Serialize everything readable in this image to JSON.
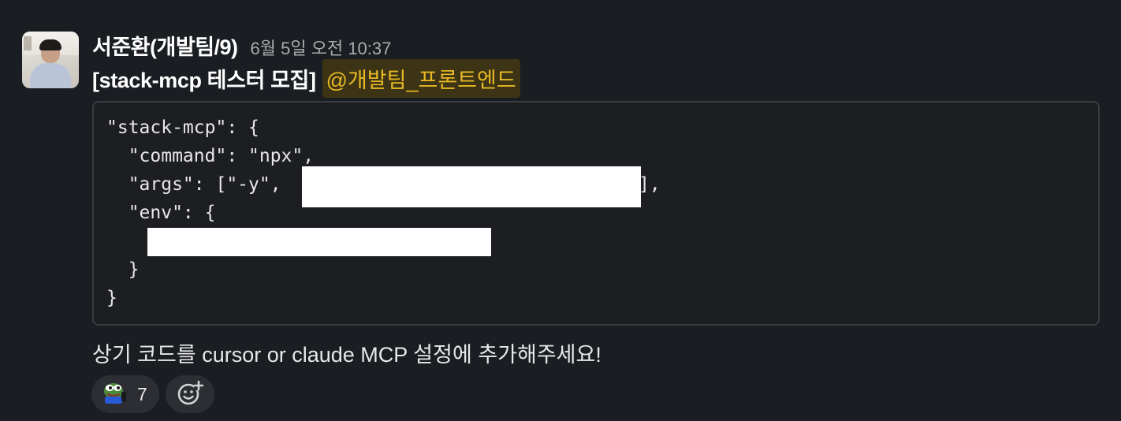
{
  "message": {
    "sender": "서준환(개발팀/9)",
    "timestamp": "6월 5일 오전 10:37",
    "title": "[stack-mcp 테스터 모집]",
    "mention": "@개발팀_프론트엔드",
    "code_lines": [
      "\"stack-mcp\": {",
      "  \"command\": \"npx\",",
      "  \"args\": [\"-y\", ",
      "  \"env\": {",
      "  }",
      "}"
    ],
    "args_suffix": "],",
    "body": "상기 코드를 cursor or claude MCP 설정에 추가해주세요!"
  },
  "reactions": [
    {
      "emoji": "pepe-frog-icon",
      "count": "7"
    }
  ],
  "colors": {
    "background": "#1a1d21",
    "mention_bg": "#3d3416",
    "mention_text": "#e8b923",
    "code_border": "#3a3c41"
  }
}
